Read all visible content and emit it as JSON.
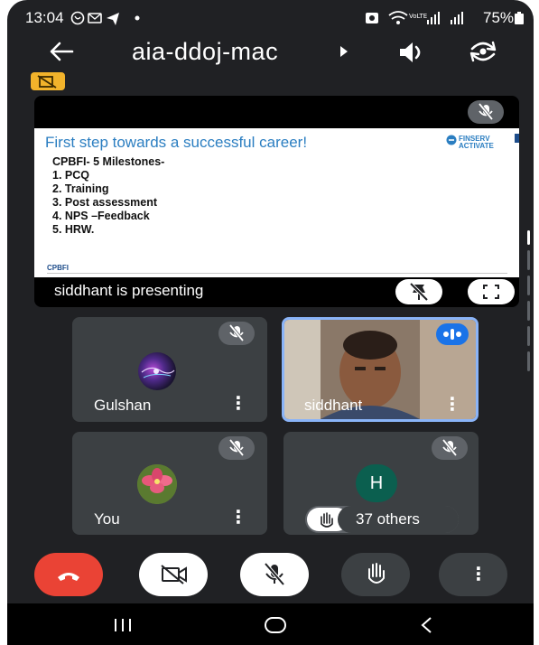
{
  "status_bar": {
    "time": "13:04",
    "battery": "75%"
  },
  "header": {
    "meeting_code": "aia-ddoj-mac"
  },
  "presentation": {
    "slide_title": "First step towards a successful career!",
    "slide_brand": "FINSERV ACTIVATE",
    "slide_subtitle": "CPBFI- 5 Milestones-",
    "slide_items": [
      "1. PCQ",
      "2. Training",
      "3. Post assessment",
      "4. NPS –Feedback",
      "5. HRW."
    ],
    "slide_footer": "CPBFI",
    "label": "siddhant is presenting"
  },
  "participants": [
    {
      "name": "Gulshan",
      "muted": true
    },
    {
      "name": "siddhant",
      "speaking": true
    },
    {
      "name": "You",
      "muted": true
    },
    {
      "initial": "H",
      "muted": true,
      "others_label": "37 others"
    }
  ],
  "colors": {
    "background": "#202124",
    "tile": "#3c4043",
    "end_call": "#ea4335",
    "avatar_h": "#0b5f4f",
    "speaking_border": "#8ab4f8",
    "rec_badge": "#f2b32b"
  },
  "icons": {
    "back": "arrow-left-icon",
    "audio": "speaker-icon",
    "camera_switch": "camera-flip-icon",
    "mic_off": "mic-off-icon",
    "pin": "pin-off-icon",
    "fullscreen": "fullscreen-icon",
    "hand": "raise-hand-icon",
    "more": "more-vert-icon",
    "end_call": "hang-up-icon",
    "video_off": "video-off-icon"
  }
}
